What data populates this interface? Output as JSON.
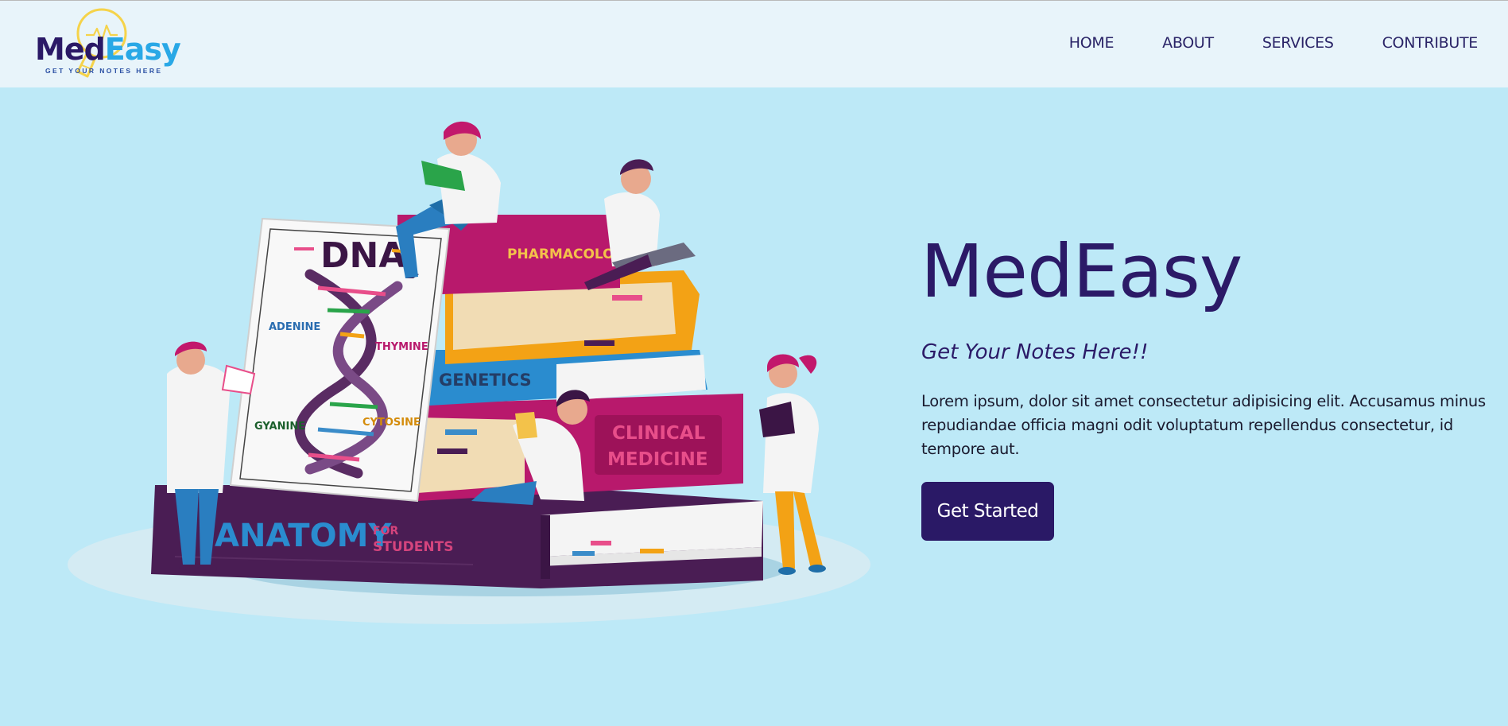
{
  "brand": {
    "logo_med": "Med",
    "logo_easy": "Easy",
    "tagline": "GET YOUR NOTES HERE"
  },
  "nav": {
    "items": [
      {
        "label": "HOME"
      },
      {
        "label": "ABOUT"
      },
      {
        "label": "SERVICES"
      },
      {
        "label": "CONTRIBUTE"
      }
    ]
  },
  "hero": {
    "title": "MedEasy",
    "subtitle": "Get Your Notes Here!!",
    "body": "Lorem ipsum, dolor sit amet consectetur adipisicing elit. Accusamus minus repudiandae officia magni odit voluptatum repellendus consectetur, id tempore aut.",
    "cta_label": "Get Started"
  },
  "illustration": {
    "dna_title": "DNA",
    "dna_labels": {
      "adenine": "ADENINE",
      "thymine": "THYMINE",
      "gyanine": "GYANINE",
      "cytosine": "CYTOSINE"
    },
    "books": {
      "pharmacology": "PHARMACOLOGY",
      "genetics": "GENETICS",
      "clinical_line1": "CLINICAL",
      "clinical_line2": "MEDICINE",
      "anatomy": "ANATOMY",
      "anatomy_for": "FOR",
      "anatomy_students": "STUDENTS"
    }
  },
  "colors": {
    "page_bg": "#bde9f7",
    "nav_bg": "#e8f4fa",
    "brand_dark": "#2a1966",
    "brand_light": "#29a8e6",
    "magenta": "#b8196c",
    "purple_book": "#4a1d54",
    "orange": "#f3a215",
    "blue_book": "#2a8ccf"
  }
}
